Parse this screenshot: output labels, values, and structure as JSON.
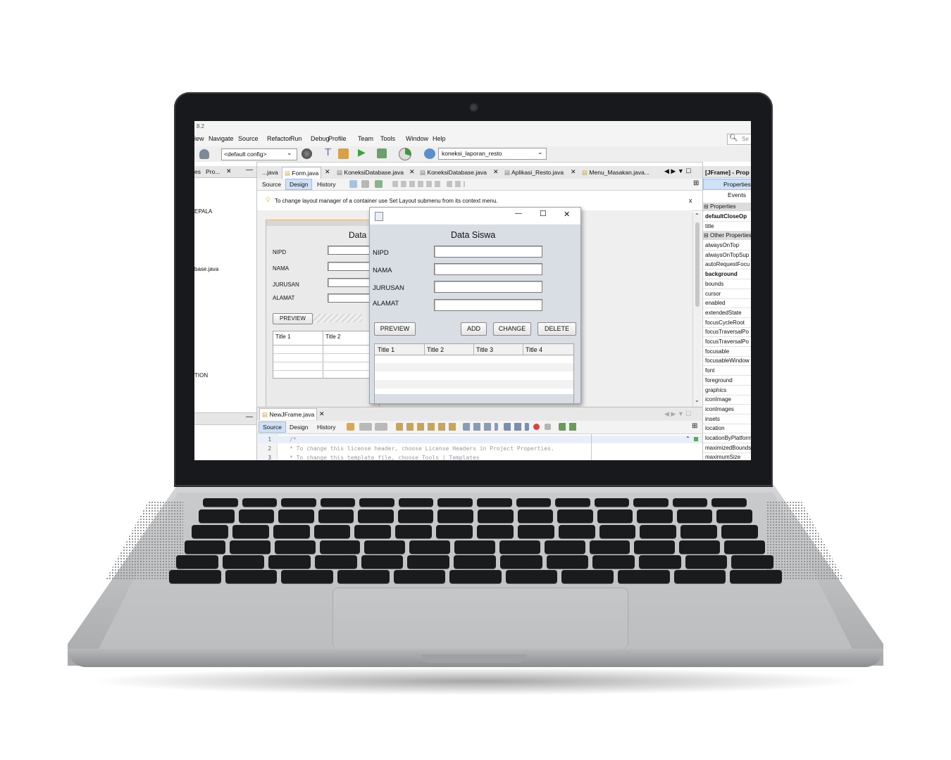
{
  "ide": {
    "title_fragment": "8.2",
    "menu": [
      "iew",
      "Navigate",
      "Source",
      "Refactor",
      "Run",
      "Debug",
      "Profile",
      "Team",
      "Tools",
      "Window",
      "Help"
    ],
    "search_placeholder": "Se",
    "config_select": "<default config>",
    "project_select": "koneksi_laporan_resto",
    "left_panel": {
      "tabs": [
        "es",
        "Pro..."
      ],
      "items": [
        "EPALA",
        "base.java",
        "TION"
      ]
    },
    "editor_tabs": [
      "...java",
      "Form.java",
      "KoneksiDatabase.java",
      "KoneksiDatabase.java",
      "Aplikasi_Resto.java",
      "Menu_Masakan.java..."
    ],
    "view_toggles": [
      "Source",
      "Design",
      "History"
    ],
    "hint": "To change layout manager of a container use Set Layout submenu from its context menu.",
    "hint_close": "x",
    "design_form": {
      "title": "Data",
      "labels": [
        "NIPD",
        "NAMA",
        "JURUSAN",
        "ALAMAT"
      ],
      "preview_button": "PREVIEW",
      "columns": [
        "Title 1",
        "Title 2"
      ]
    },
    "bottom_editor": {
      "tab": "NewJFrame.java",
      "toggles": [
        "Source",
        "Design",
        "History"
      ],
      "lines": [
        {
          "no": "1",
          "text": "/*"
        },
        {
          "no": "2",
          "text": " * To change this license header, choose License Headers in Project Properties."
        },
        {
          "no": "3",
          "text": " * To change this template file, choose Tools | Templates"
        }
      ]
    },
    "properties_panel": {
      "title": "[JFrame] - Prop",
      "tabs": [
        "Properties",
        "Events"
      ],
      "section1": "Properties",
      "section1_items": [
        "defaultCloseOp",
        "title"
      ],
      "section2": "Other Properties",
      "section2_items": [
        "alwaysOnTop",
        "alwaysOnTopSup",
        "autoRequestFocu",
        "background",
        "bounds",
        "cursor",
        "enabled",
        "extendedState",
        "focusCycleRoot",
        "focusTraversalPo",
        "focusTraversalPo",
        "focusable",
        "focusableWindow",
        "font",
        "foreground",
        "graphics",
        "iconImage",
        "iconImages",
        "insets",
        "location",
        "locationByPlatform",
        "maximizedBounds",
        "maximumSize"
      ]
    }
  },
  "dialog": {
    "minimize": "—",
    "maximize": "☐",
    "close": "✕",
    "heading": "Data Siswa",
    "fields": [
      {
        "label": "NIPD",
        "value": ""
      },
      {
        "label": "NAMA",
        "value": ""
      },
      {
        "label": "JURUSAN",
        "value": ""
      },
      {
        "label": "ALAMAT",
        "value": ""
      }
    ],
    "buttons": {
      "preview": "PREVIEW",
      "add": "ADD",
      "change": "CHANGE",
      "delete": "DELETE"
    },
    "table_columns": [
      "Title 1",
      "Title 2",
      "Title 3",
      "Title 4"
    ]
  }
}
